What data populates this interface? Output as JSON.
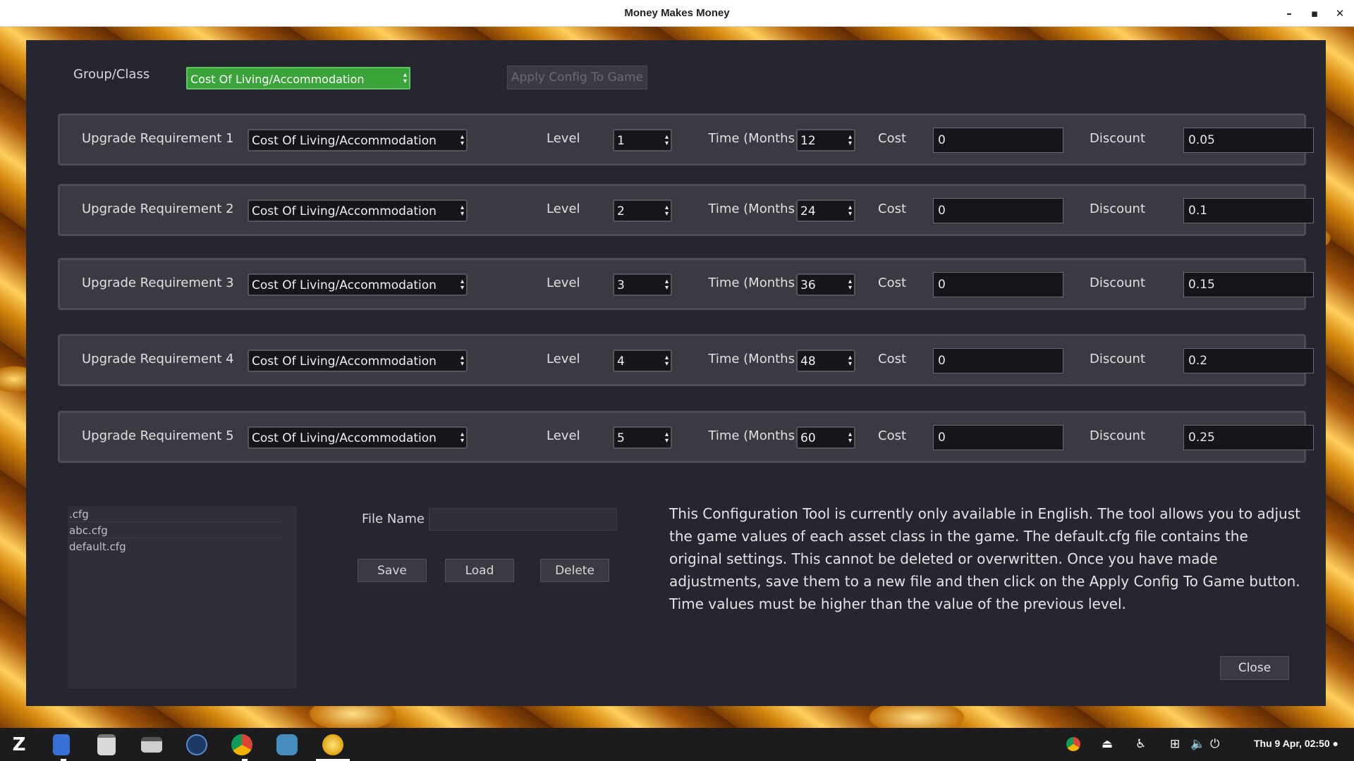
{
  "window": {
    "title": "Money Makes Money",
    "minimize": "–",
    "maximize": "▪",
    "close": "✕"
  },
  "header": {
    "group_label": "Group/Class",
    "group_value": "Cost Of Living/Accommodation",
    "apply_label": "Apply Config To Game"
  },
  "requirements": [
    {
      "label": "Upgrade Requirement 1",
      "class": "Cost Of Living/Accommodation",
      "level_label": "Level",
      "level": "1",
      "time_label": "Time (Months)",
      "time": "12",
      "cost_label": "Cost",
      "cost": "0",
      "discount_label": "Discount",
      "discount": "0.05"
    },
    {
      "label": "Upgrade Requirement 2",
      "class": "Cost Of Living/Accommodation",
      "level_label": "Level",
      "level": "2",
      "time_label": "Time (Months)",
      "time": "24",
      "cost_label": "Cost",
      "cost": "0",
      "discount_label": "Discount",
      "discount": "0.1"
    },
    {
      "label": "Upgrade Requirement 3",
      "class": "Cost Of Living/Accommodation",
      "level_label": "Level",
      "level": "3",
      "time_label": "Time (Months)",
      "time": "36",
      "cost_label": "Cost",
      "cost": "0",
      "discount_label": "Discount",
      "discount": "0.15"
    },
    {
      "label": "Upgrade Requirement 4",
      "class": "Cost Of Living/Accommodation",
      "level_label": "Level",
      "level": "4",
      "time_label": "Time (Months)",
      "time": "48",
      "cost_label": "Cost",
      "cost": "0",
      "discount_label": "Discount",
      "discount": "0.2"
    },
    {
      "label": "Upgrade Requirement 5",
      "class": "Cost Of Living/Accommodation",
      "level_label": "Level",
      "level": "5",
      "time_label": "Time (Months)",
      "time": "60",
      "cost_label": "Cost",
      "cost": "0",
      "discount_label": "Discount",
      "discount": "0.25"
    }
  ],
  "files": {
    "items": [
      ".cfg",
      "abc.cfg",
      "default.cfg"
    ],
    "name_label": "File Name",
    "name_value": "",
    "save_label": "Save",
    "load_label": "Load",
    "delete_label": "Delete"
  },
  "description": "This Configuration Tool is currently only available in English.  The tool allows you to adjust the game values of each asset class in the game.  The default.cfg file contains the original settings. This cannot be deleted or overwritten.  Once you have made adjustments, save them to a new file and then click on the Apply Config To Game button.  Time values must be higher than the value of the previous level.",
  "close_label": "Close",
  "taskbar": {
    "apps": [
      "zorin-menu-icon",
      "files-icon",
      "clipboard-icon",
      "scanner-icon",
      "steam-icon",
      "chrome-icon",
      "godot-icon",
      "money-app-icon"
    ],
    "clock": "Thu  9 Apr, 02:50 ●"
  },
  "colors": {
    "group_select_bg": "#3aa33a",
    "app_bg": "#262630",
    "row_bg": "#3a3a42"
  }
}
